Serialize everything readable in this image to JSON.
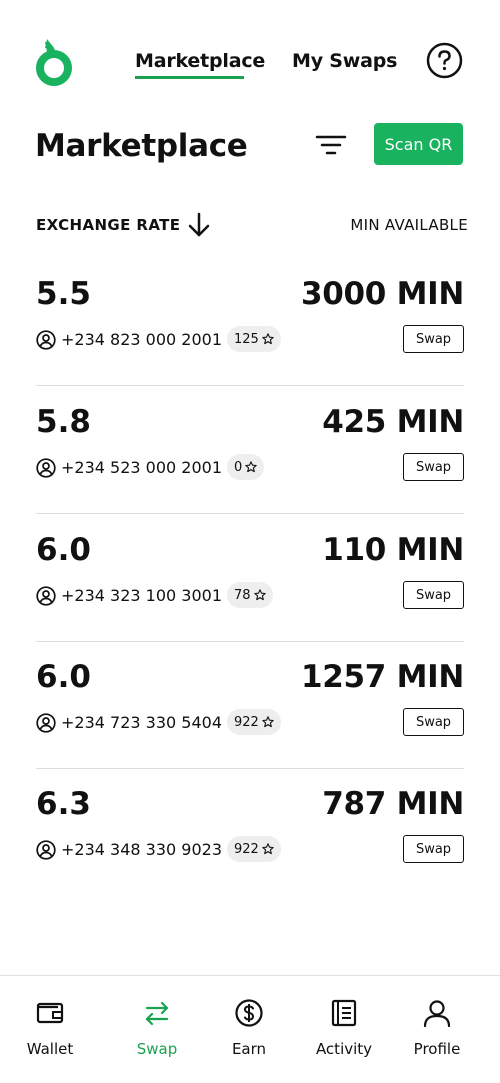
{
  "header": {
    "tabs": [
      {
        "label": "Marketplace",
        "active": true
      },
      {
        "label": "My Swaps",
        "active": false
      }
    ],
    "logo_icon": "leaf-logo-icon",
    "help_icon": "question-circle-icon"
  },
  "page": {
    "title": "Marketplace",
    "filter_icon": "filter-icon",
    "scan_button": "Scan QR"
  },
  "sort": {
    "exchange_rate_label": "EXCHANGE RATE",
    "sort_icon": "arrow-down-icon",
    "min_available_label": "MIN AVAILABLE"
  },
  "offers": [
    {
      "rate": "5.5",
      "amount": "3000 MIN",
      "phone": "+234 823 000 2001",
      "rating": "125",
      "action": "Swap"
    },
    {
      "rate": "5.8",
      "amount": "425 MIN",
      "phone": "+234 523 000 2001",
      "rating": "0",
      "action": "Swap"
    },
    {
      "rate": "6.0",
      "amount": "110 MIN",
      "phone": "+234 323 100 3001",
      "rating": "78",
      "action": "Swap"
    },
    {
      "rate": "6.0",
      "amount": "1257 MIN",
      "phone": "+234 723 330 5404",
      "rating": "922",
      "action": "Swap"
    },
    {
      "rate": "6.3",
      "amount": "787 MIN",
      "phone": "+234 348 330 9023",
      "rating": "922",
      "action": "Swap"
    }
  ],
  "bottom_nav": [
    {
      "label": "Wallet",
      "icon": "wallet-icon",
      "active": false
    },
    {
      "label": "Swap",
      "icon": "swap-arrows-icon",
      "active": true
    },
    {
      "label": "Earn",
      "icon": "dollar-circle-icon",
      "active": false
    },
    {
      "label": "Activity",
      "icon": "activity-list-icon",
      "active": false
    },
    {
      "label": "Profile",
      "icon": "user-icon",
      "active": false
    }
  ],
  "colors": {
    "accent": "#19b25f",
    "text": "#111111",
    "badge_bg": "#eeeeee",
    "divider": "#dddddd"
  }
}
